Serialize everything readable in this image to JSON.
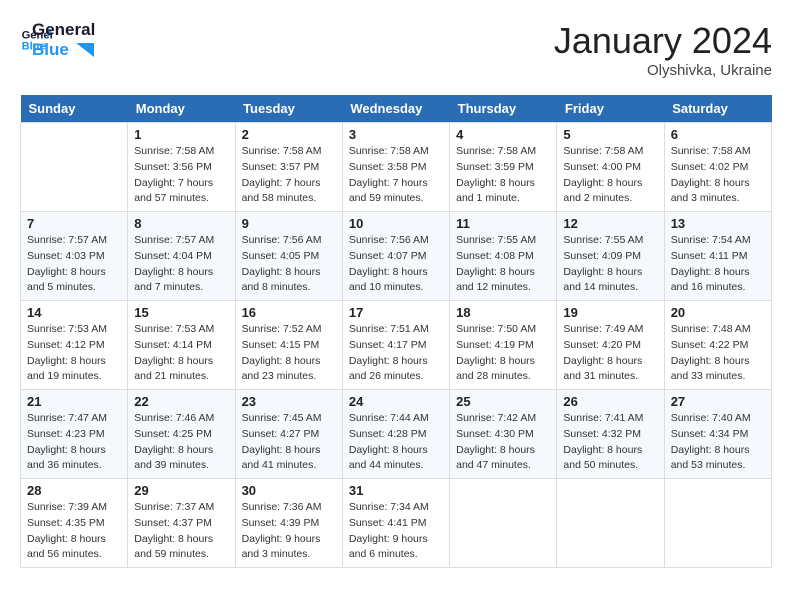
{
  "header": {
    "logo_line1": "General",
    "logo_line2": "Blue",
    "month": "January 2024",
    "location": "Olyshivka, Ukraine"
  },
  "days_of_week": [
    "Sunday",
    "Monday",
    "Tuesday",
    "Wednesday",
    "Thursday",
    "Friday",
    "Saturday"
  ],
  "weeks": [
    [
      {
        "day": "",
        "info": ""
      },
      {
        "day": "1",
        "info": "Sunrise: 7:58 AM\nSunset: 3:56 PM\nDaylight: 7 hours\nand 57 minutes."
      },
      {
        "day": "2",
        "info": "Sunrise: 7:58 AM\nSunset: 3:57 PM\nDaylight: 7 hours\nand 58 minutes."
      },
      {
        "day": "3",
        "info": "Sunrise: 7:58 AM\nSunset: 3:58 PM\nDaylight: 7 hours\nand 59 minutes."
      },
      {
        "day": "4",
        "info": "Sunrise: 7:58 AM\nSunset: 3:59 PM\nDaylight: 8 hours\nand 1 minute."
      },
      {
        "day": "5",
        "info": "Sunrise: 7:58 AM\nSunset: 4:00 PM\nDaylight: 8 hours\nand 2 minutes."
      },
      {
        "day": "6",
        "info": "Sunrise: 7:58 AM\nSunset: 4:02 PM\nDaylight: 8 hours\nand 3 minutes."
      }
    ],
    [
      {
        "day": "7",
        "info": "Sunrise: 7:57 AM\nSunset: 4:03 PM\nDaylight: 8 hours\nand 5 minutes."
      },
      {
        "day": "8",
        "info": "Sunrise: 7:57 AM\nSunset: 4:04 PM\nDaylight: 8 hours\nand 7 minutes."
      },
      {
        "day": "9",
        "info": "Sunrise: 7:56 AM\nSunset: 4:05 PM\nDaylight: 8 hours\nand 8 minutes."
      },
      {
        "day": "10",
        "info": "Sunrise: 7:56 AM\nSunset: 4:07 PM\nDaylight: 8 hours\nand 10 minutes."
      },
      {
        "day": "11",
        "info": "Sunrise: 7:55 AM\nSunset: 4:08 PM\nDaylight: 8 hours\nand 12 minutes."
      },
      {
        "day": "12",
        "info": "Sunrise: 7:55 AM\nSunset: 4:09 PM\nDaylight: 8 hours\nand 14 minutes."
      },
      {
        "day": "13",
        "info": "Sunrise: 7:54 AM\nSunset: 4:11 PM\nDaylight: 8 hours\nand 16 minutes."
      }
    ],
    [
      {
        "day": "14",
        "info": "Sunrise: 7:53 AM\nSunset: 4:12 PM\nDaylight: 8 hours\nand 19 minutes."
      },
      {
        "day": "15",
        "info": "Sunrise: 7:53 AM\nSunset: 4:14 PM\nDaylight: 8 hours\nand 21 minutes."
      },
      {
        "day": "16",
        "info": "Sunrise: 7:52 AM\nSunset: 4:15 PM\nDaylight: 8 hours\nand 23 minutes."
      },
      {
        "day": "17",
        "info": "Sunrise: 7:51 AM\nSunset: 4:17 PM\nDaylight: 8 hours\nand 26 minutes."
      },
      {
        "day": "18",
        "info": "Sunrise: 7:50 AM\nSunset: 4:19 PM\nDaylight: 8 hours\nand 28 minutes."
      },
      {
        "day": "19",
        "info": "Sunrise: 7:49 AM\nSunset: 4:20 PM\nDaylight: 8 hours\nand 31 minutes."
      },
      {
        "day": "20",
        "info": "Sunrise: 7:48 AM\nSunset: 4:22 PM\nDaylight: 8 hours\nand 33 minutes."
      }
    ],
    [
      {
        "day": "21",
        "info": "Sunrise: 7:47 AM\nSunset: 4:23 PM\nDaylight: 8 hours\nand 36 minutes."
      },
      {
        "day": "22",
        "info": "Sunrise: 7:46 AM\nSunset: 4:25 PM\nDaylight: 8 hours\nand 39 minutes."
      },
      {
        "day": "23",
        "info": "Sunrise: 7:45 AM\nSunset: 4:27 PM\nDaylight: 8 hours\nand 41 minutes."
      },
      {
        "day": "24",
        "info": "Sunrise: 7:44 AM\nSunset: 4:28 PM\nDaylight: 8 hours\nand 44 minutes."
      },
      {
        "day": "25",
        "info": "Sunrise: 7:42 AM\nSunset: 4:30 PM\nDaylight: 8 hours\nand 47 minutes."
      },
      {
        "day": "26",
        "info": "Sunrise: 7:41 AM\nSunset: 4:32 PM\nDaylight: 8 hours\nand 50 minutes."
      },
      {
        "day": "27",
        "info": "Sunrise: 7:40 AM\nSunset: 4:34 PM\nDaylight: 8 hours\nand 53 minutes."
      }
    ],
    [
      {
        "day": "28",
        "info": "Sunrise: 7:39 AM\nSunset: 4:35 PM\nDaylight: 8 hours\nand 56 minutes."
      },
      {
        "day": "29",
        "info": "Sunrise: 7:37 AM\nSunset: 4:37 PM\nDaylight: 8 hours\nand 59 minutes."
      },
      {
        "day": "30",
        "info": "Sunrise: 7:36 AM\nSunset: 4:39 PM\nDaylight: 9 hours\nand 3 minutes."
      },
      {
        "day": "31",
        "info": "Sunrise: 7:34 AM\nSunset: 4:41 PM\nDaylight: 9 hours\nand 6 minutes."
      },
      {
        "day": "",
        "info": ""
      },
      {
        "day": "",
        "info": ""
      },
      {
        "day": "",
        "info": ""
      }
    ]
  ]
}
